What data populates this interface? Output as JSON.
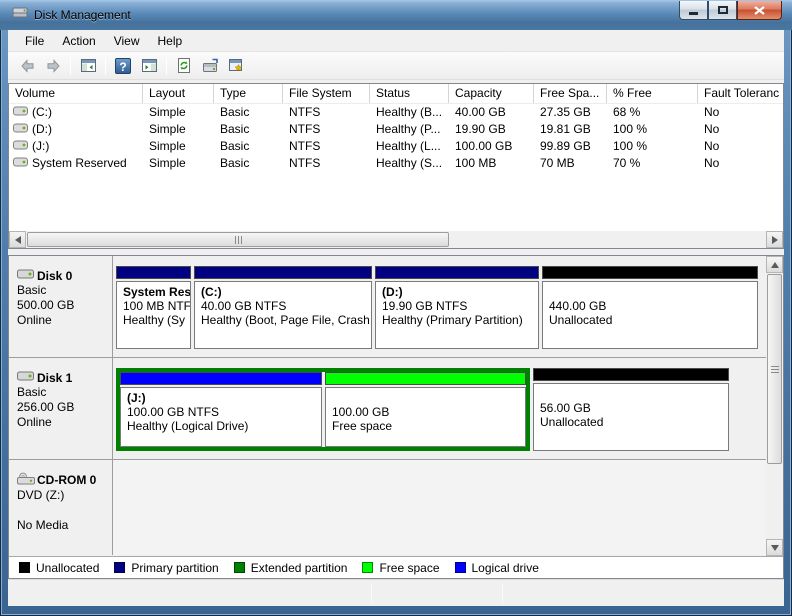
{
  "window": {
    "title": "Disk Management"
  },
  "menu": {
    "items": [
      "File",
      "Action",
      "View",
      "Help"
    ]
  },
  "toolbar": {
    "icons": [
      "back",
      "forward",
      "show-console-tree",
      "help",
      "show-action-pane",
      "refresh",
      "disk-properties",
      "rescan-disks"
    ],
    "help_glyph": "?"
  },
  "table": {
    "columns": [
      "Volume",
      "Layout",
      "Type",
      "File System",
      "Status",
      "Capacity",
      "Free Spa...",
      "% Free",
      "Fault Toleranc"
    ],
    "rows": [
      [
        "(C:)",
        "Simple",
        "Basic",
        "NTFS",
        "Healthy (B...",
        "40.00 GB",
        "27.35 GB",
        "68 %",
        "No"
      ],
      [
        "(D:)",
        "Simple",
        "Basic",
        "NTFS",
        "Healthy (P...",
        "19.90 GB",
        "19.81 GB",
        "100 %",
        "No"
      ],
      [
        "(J:)",
        "Simple",
        "Basic",
        "NTFS",
        "Healthy (L...",
        "100.00 GB",
        "99.89 GB",
        "100 %",
        "No"
      ],
      [
        "System Reserved",
        "Simple",
        "Basic",
        "NTFS",
        "Healthy (S...",
        "100 MB",
        "70 MB",
        "70 %",
        "No"
      ]
    ]
  },
  "disks": [
    {
      "label": "Disk 0",
      "lines": [
        "Basic",
        "500.00 GB",
        "Online"
      ],
      "partitions": [
        {
          "title": "System Res",
          "size_line": "100 MB NTF",
          "status_line": "Healthy (Sy"
        },
        {
          "title": "(C:)",
          "size_line": "40.00 GB NTFS",
          "status_line": "Healthy (Boot, Page File, Crash"
        },
        {
          "title": "(D:)",
          "size_line": "19.90 GB NTFS",
          "status_line": "Healthy (Primary Partition)"
        },
        {
          "title": "",
          "size_line": "440.00 GB",
          "status_line": "Unallocated"
        }
      ]
    },
    {
      "label": "Disk 1",
      "lines": [
        "Basic",
        "256.00 GB",
        "Online"
      ],
      "partitions": [
        {
          "title": "(J:)",
          "size_line": "100.00 GB NTFS",
          "status_line": "Healthy (Logical Drive)"
        },
        {
          "title": "",
          "size_line": "100.00 GB",
          "status_line": "Free space"
        },
        {
          "title": "",
          "size_line": "56.00 GB",
          "status_line": "Unallocated"
        }
      ]
    },
    {
      "label": "CD-ROM 0",
      "lines": [
        "DVD (Z:)",
        "",
        "No Media"
      ]
    }
  ],
  "legend": {
    "items": [
      {
        "label": "Unallocated",
        "color": "#000000"
      },
      {
        "label": "Primary partition",
        "color": "#000080"
      },
      {
        "label": "Extended partition",
        "color": "#008000"
      },
      {
        "label": "Free space",
        "color": "#00ff00"
      },
      {
        "label": "Logical drive",
        "color": "#0000ff"
      }
    ]
  },
  "colors": {
    "unallocated": "#000000",
    "primary": "#000080",
    "extended": "#008000",
    "free": "#00ff00",
    "logical": "#0000ff"
  }
}
